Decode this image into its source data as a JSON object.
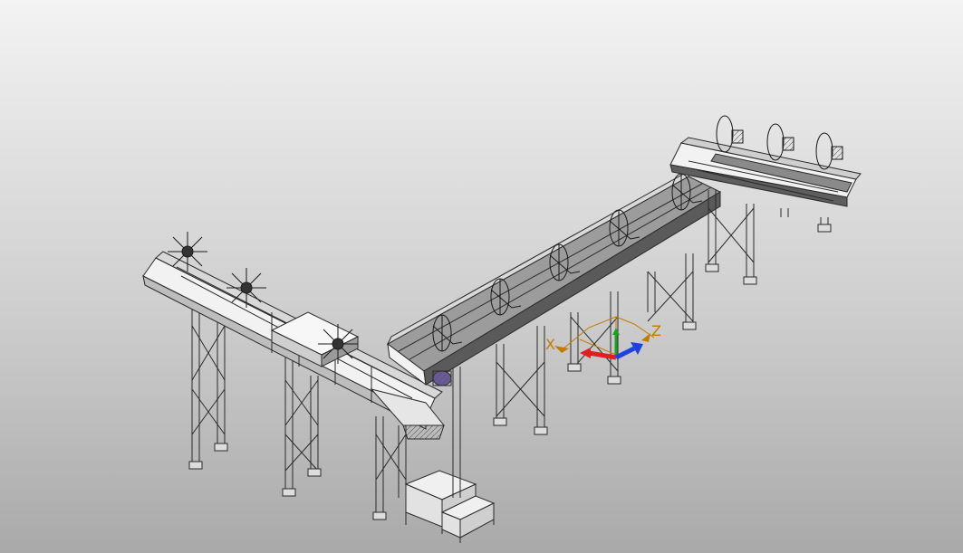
{
  "triad": {
    "x_label": "X",
    "z_label": "Z",
    "colors": {
      "x_arrow": "#e02020",
      "y_arrow": "#20a020",
      "z_arrow": "#2040e0",
      "label": "#c47a00"
    }
  },
  "model": {
    "line_color": "#2a2a2a",
    "face_light": "#f4f4f4",
    "face_dark": "#6c6c6c",
    "face_mid": "#bdbdbd"
  },
  "background": {
    "top": "#f3f3f3",
    "bottom": "#a9a9a9"
  }
}
